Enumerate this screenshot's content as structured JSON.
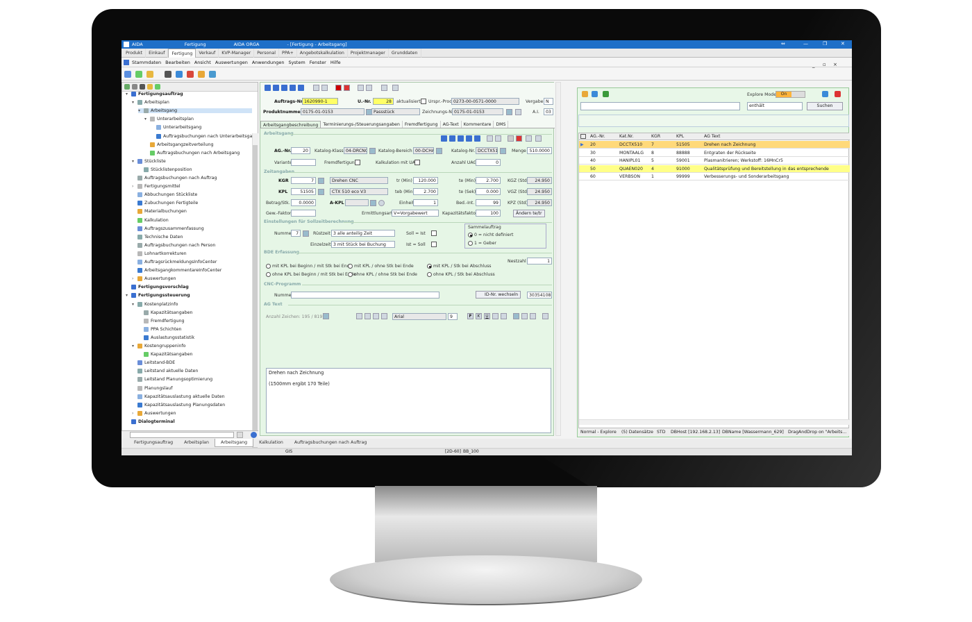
{
  "titlebar": {
    "app": "AIDA",
    "module": "Fertigung",
    "orga": "AIDA ORGA",
    "doc": "- [Fertigung - Arbeitsgang]"
  },
  "module_tabs": [
    "Produkt",
    "Einkauf",
    "Fertigung",
    "Verkauf",
    "KVP-Manager",
    "Personal",
    "PPA+",
    "Angebotskalkulation",
    "Projektmanager",
    "Grunddaten"
  ],
  "menu": [
    "Stammdaten",
    "Bearbeiten",
    "Ansicht",
    "Auswertungen",
    "Anwendungen",
    "System",
    "Fenster",
    "Hilfe"
  ],
  "tree": [
    {
      "label": "Fertigungsauftrag",
      "bold": true
    },
    {
      "label": "Arbeitsplan"
    },
    {
      "label": "Arbeitsgang"
    },
    {
      "label": "Unterarbeitsplan"
    },
    {
      "label": "Unterarbeitsgang"
    },
    {
      "label": "Auftragsbuchungen nach Unterarbeitsgang"
    },
    {
      "label": "Arbeitsgangzeitverteilung"
    },
    {
      "label": "Auftragsbuchungen nach Arbeitsgang"
    },
    {
      "label": "Stückliste"
    },
    {
      "label": "Stücklistenposition"
    },
    {
      "label": "Auftragsbuchungen nach Auftrag"
    },
    {
      "label": "Fertigungsmittel"
    },
    {
      "label": "Abbuchungen Stückliste"
    },
    {
      "label": "Zubuchungen Fertigteile"
    },
    {
      "label": "Materialbuchungen"
    },
    {
      "label": "Kalkulation"
    },
    {
      "label": "Auftragszusammenfassung"
    },
    {
      "label": "Technische Daten"
    },
    {
      "label": "Auftragsbuchungen nach Person"
    },
    {
      "label": "Lohnartkorrekturen"
    },
    {
      "label": "AuftragsrückmeldungsInfoCenter"
    },
    {
      "label": "ArbeitsgangkommentareInfoCenter"
    },
    {
      "label": "Auswertungen"
    },
    {
      "label": "Fertigungsvorschlag",
      "bold": true
    },
    {
      "label": "Fertigungssteuerung",
      "bold": true
    },
    {
      "label": "Kostenplatzinfo"
    },
    {
      "label": "Kapazitätsangaben"
    },
    {
      "label": "Fremdfertigung"
    },
    {
      "label": "PPA Schichten"
    },
    {
      "label": "Auslastungsstatistik"
    },
    {
      "label": "Kostengruppeninfo"
    },
    {
      "label": "Kapazitätsangaben"
    },
    {
      "label": "Leitstand-BDE"
    },
    {
      "label": "Leitstand aktuelle Daten"
    },
    {
      "label": "Leitstand Planungsoptimierung"
    },
    {
      "label": "Planungslauf"
    },
    {
      "label": "Kapazitätsauslastung aktuelle Daten"
    },
    {
      "label": "Kapazitätsauslastung Planungsdaten"
    },
    {
      "label": "Auswertungen"
    },
    {
      "label": "Dialogterminal",
      "bold": true
    }
  ],
  "bottom_tabs": [
    "Fertigungsauftrag",
    "Arbeitsplan",
    "Arbeitsgang",
    "Kalkulation",
    "Auftragsbuchungen nach Auftrag"
  ],
  "status": {
    "gis": "GIS",
    "coords": "[2D-60]",
    "bb": "BB_100"
  },
  "header": {
    "auftrag_label": "Auftrags-Nr.",
    "auftrag": "1620990-1",
    "unr_label": "U.-Nr.",
    "unr": "28",
    "aktualisiert": "aktualisiert?",
    "urspr_label": "Urspr.-Prod.",
    "urspr": "0273-00-0571-0000",
    "vergabe_label": "Vergabe",
    "vergabe": "N",
    "produkt_label": "Produktnummer",
    "produkt": "0175-01-0153",
    "produkt_name": "Passstück",
    "zeichnung_label": "Zeichnungs-Nr.",
    "zeichnung": "0175-01-0153",
    "ai_label": "A.I.",
    "ai": "03"
  },
  "center_tabs": [
    "Arbeitsgangbeschreibung",
    "Terminierungs-/Steuerungsangaben",
    "Fremdfertigung",
    "AG-Text",
    "Kommentare",
    "DMS"
  ],
  "arbeitsgang": {
    "section": "Arbeitsgang",
    "agnr_label": "AG.-Nr.",
    "agnr": "20",
    "katklasse_label": "Katalog-Klasse",
    "katklasse": "04-DRCNC",
    "katbereich_label": "Katalog-Bereich",
    "katbereich": "00-DCHA",
    "katnr_label": "Katalog-Nr.",
    "katnr": "DCCTX510",
    "menge_label": "Menge",
    "menge": "510.0000",
    "variante_label": "Variante",
    "fremd_label": "Fremdfertigung",
    "kalk_label": "Kalkulation mit UAG",
    "anzahl_label": "Anzahl UAG",
    "anzahl": "0"
  },
  "zeitangaben": {
    "section": "Zeitangaben",
    "kgr_label": "KGR",
    "kgr": "7",
    "kgr_name": "Drehen CNC",
    "tr_label": "tr (Min)",
    "tr": "120.000",
    "te_min_label": "te (Min)",
    "te_min": "2.700",
    "kgz_label": "KGZ (Std)",
    "kgz": "24.950",
    "kpl_label": "KPL",
    "kpl": "51505",
    "kpl_name": "CTX 510 eco V3",
    "teb_label": "teb (Min)",
    "teb": "2.700",
    "te_sek_label": "te (Sek)",
    "te_sek": "0.000",
    "vgz_label": "VGZ (Std)",
    "vgz": "24.950",
    "betrag_label": "Betrag/Stk.",
    "betrag": "0.0000",
    "akpl_label": "A-KPL",
    "einheit_label": "Einheit",
    "einheit": "1",
    "bedint_label": "Bed.-Int.",
    "bedint": "99",
    "kpz_label": "KPZ (Std)",
    "kpz": "24.950",
    "gew_label": "Gew.-Faktor",
    "ermitt_label": "Ermittlungsart",
    "ermitt": "V=Vorgabewert",
    "kapfak_label": "Kapazitätsfaktor",
    "kapfak": "100",
    "aendern": "Ändern te/tr"
  },
  "soll": {
    "section": "Einstellungen für Sollzeitberechnung",
    "nummer_label": "Nummer",
    "nummer": "7",
    "ruest_label": "Rüstzeit",
    "ruest": "3 alle anteilig Zeit",
    "einzel_label": "Einzelzeit",
    "einzel": "3 mit Stück bei Buchung",
    "sollist": "Soll = Ist",
    "istsoll": "Ist = Soll",
    "sammel": "Sammelauftrag",
    "sammel0": "0 = nicht definiert",
    "sammel1": "1 = Geber"
  },
  "bde": {
    "section": "BDE Erfassung",
    "o1": "mit KPL bei Beginn / mit Stk bei Ende",
    "o2": "mit KPL / ohne Stk bei Ende",
    "o3": "mit KPL / Stk bei Abschluss",
    "o4": "ohne KPL bei Beginn / mit Stk bei Ende",
    "o5": "ohne KPL / ohne Stk bei Ende",
    "o6": "ohne KPL / Stk bei Abschluss",
    "nest_label": "Nestzahl",
    "nest": "1"
  },
  "cnc": {
    "section": "CNC-Programm",
    "nummer_label": "Nummer",
    "wechseln": "ID-Nr. wechseln",
    "id": "30354108"
  },
  "agtext": {
    "section": "AG Text",
    "zeichen": "Anzahl Zeichen: 195 / 8191",
    "font": "Arial",
    "size": "9",
    "line1": "Drehen nach Zeichnung",
    "line2": "(1500mm ergibt 170 Teile)"
  },
  "right": {
    "explore_label": "Explore Mode",
    "explore": "On",
    "filter": "enthält",
    "suchen": "Suchen",
    "columns": [
      "AG.-Nr.",
      "Kat.Nr.",
      "KGR",
      "KPL",
      "AG Text"
    ],
    "rows": [
      {
        "ag": "20",
        "kat": "DCCTX510",
        "kgr": "7",
        "kpl": "51505",
        "text": "Drehen nach Zeichnung",
        "style": "sel"
      },
      {
        "ag": "30",
        "kat": "MONTAALG",
        "kgr": "8",
        "kpl": "88888",
        "text": "Entgraten der Rückseite",
        "style": ""
      },
      {
        "ag": "40",
        "kat": "HANIPL01",
        "kgr": "5",
        "kpl": "59001",
        "text": "Plasmanitrieren;  Werkstoff: 16MnCr5",
        "style": ""
      },
      {
        "ag": "50",
        "kat": "QUAEN020",
        "kgr": "4",
        "kpl": "91000",
        "text": "Qualitätsprüfung und Bereitstellung in das entsprechende",
        "style": "y"
      },
      {
        "ag": "60",
        "kat": "VERBSON",
        "kgr": "1",
        "kpl": "99999",
        "text": "Verbesserungs- und Sonderarbeitsgang",
        "style": ""
      }
    ],
    "status": [
      "Normal - Explore",
      "(5) Datensätze",
      "STD",
      "DBHost  [192.168.2.13]",
      "DBName  [Wassermann_629]",
      "DragAndDrop on \"Arbeits..."
    ]
  }
}
